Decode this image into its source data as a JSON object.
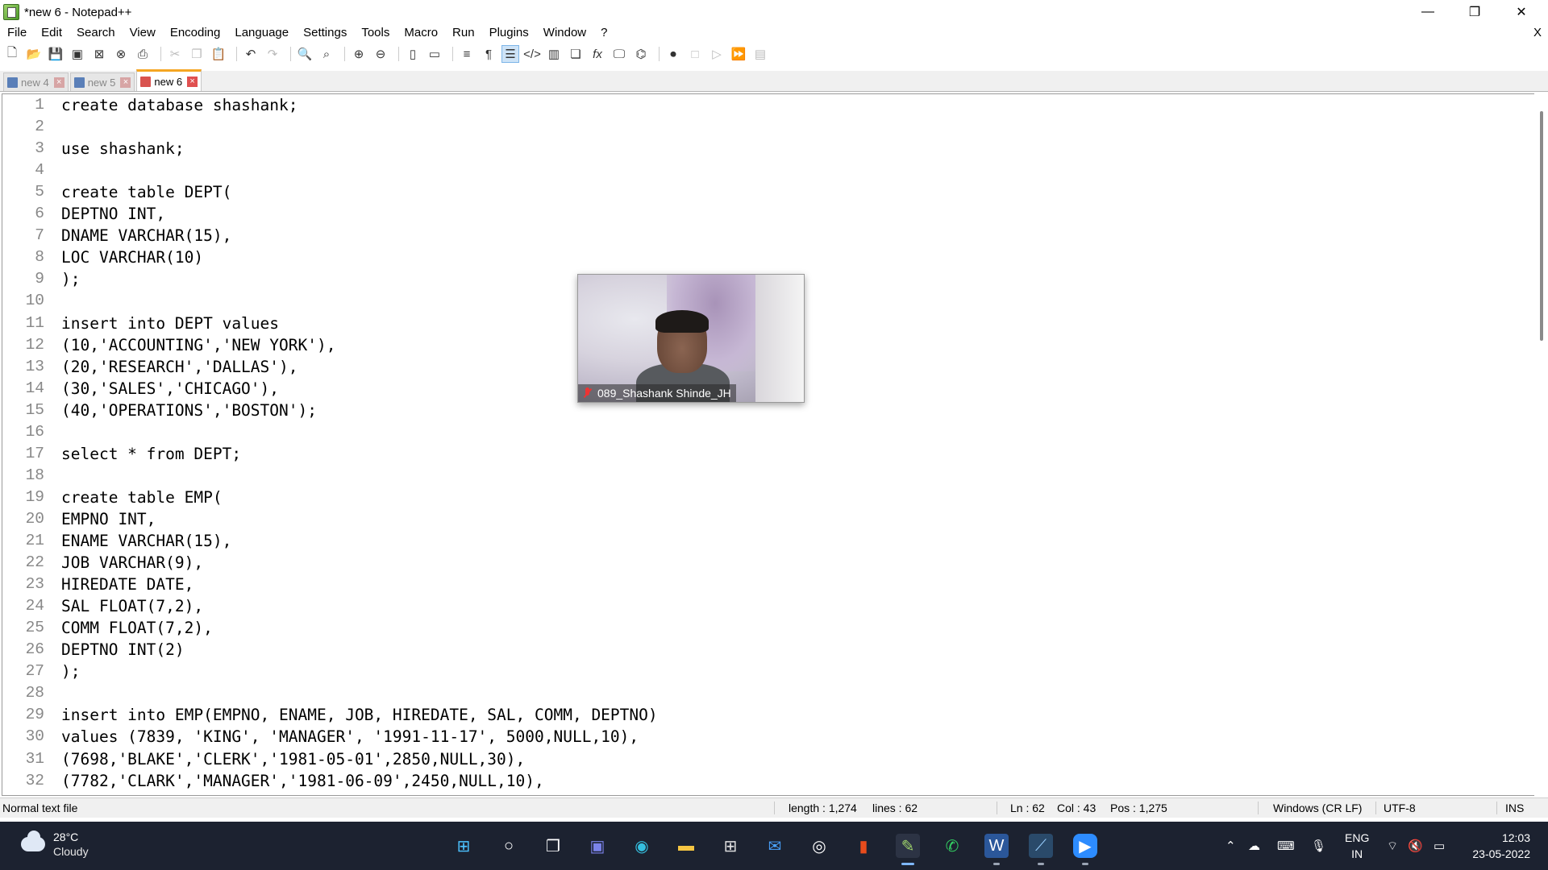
{
  "window": {
    "title": "*new 6 - Notepad++",
    "minimize_glyph": "—",
    "restore_glyph": "❐",
    "close_glyph": "✕"
  },
  "menu": {
    "items": [
      "File",
      "Edit",
      "Search",
      "View",
      "Encoding",
      "Language",
      "Settings",
      "Tools",
      "Macro",
      "Run",
      "Plugins",
      "Window",
      "?"
    ],
    "close_doc": "X"
  },
  "toolbar": {
    "icons": [
      "new-file-icon",
      "open-file-icon",
      "save-icon",
      "save-all-icon",
      "close-icon",
      "close-all-icon",
      "print-icon",
      "cut-icon",
      "copy-icon",
      "paste-icon",
      "undo-icon",
      "redo-icon",
      "find-icon",
      "replace-icon",
      "zoom-in-icon",
      "zoom-out-icon",
      "sync-vertical-icon",
      "sync-horizontal-icon",
      "word-wrap-icon",
      "show-all-chars-icon",
      "indent-guide-icon",
      "xml-tag-icon",
      "document-map-icon",
      "function-list-icon",
      "fx-icon",
      "monitor-icon",
      "folder-workspace-icon",
      "record-macro-icon",
      "stop-macro-icon",
      "play-macro-icon",
      "run-multiple-macro-icon",
      "save-macro-icon"
    ]
  },
  "tabs": [
    {
      "label": "new 4",
      "active": false
    },
    {
      "label": "new 5",
      "active": false
    },
    {
      "label": "new 6",
      "active": true
    }
  ],
  "editor": {
    "lines": [
      "create database shashank;",
      "",
      "use shashank;",
      "",
      "create table DEPT(",
      "DEPTNO INT,",
      "DNAME VARCHAR(15),",
      "LOC VARCHAR(10)",
      ");",
      "",
      "insert into DEPT values",
      "(10,'ACCOUNTING','NEW YORK'),",
      "(20,'RESEARCH','DALLAS'),",
      "(30,'SALES','CHICAGO'),",
      "(40,'OPERATIONS','BOSTON');",
      "",
      "select * from DEPT;",
      "",
      "create table EMP(",
      "EMPNO INT,",
      "ENAME VARCHAR(15),",
      "JOB VARCHAR(9),",
      "HIREDATE DATE,",
      "SAL FLOAT(7,2),",
      "COMM FLOAT(7,2),",
      "DEPTNO INT(2)",
      ");",
      "",
      "insert into EMP(EMPNO, ENAME, JOB, HIREDATE, SAL, COMM, DEPTNO)",
      "values (7839, 'KING', 'MANAGER', '1991-11-17', 5000,NULL,10),",
      "(7698,'BLAKE','CLERK','1981-05-01',2850,NULL,30),",
      "(7782,'CLARK','MANAGER','1981-06-09',2450,NULL,10),"
    ]
  },
  "video": {
    "participant": "089_Shashank Shinde_JH"
  },
  "status": {
    "file_type": "Normal text file",
    "length": "length : 1,274",
    "lines": "lines : 62",
    "ln": "Ln : 62",
    "col": "Col : 43",
    "pos": "Pos : 1,275",
    "eol": "Windows (CR LF)",
    "encoding": "UTF-8",
    "mode": "INS"
  },
  "taskbar": {
    "weather_temp": "28°C",
    "weather_desc": "Cloudy",
    "lang_line1": "ENG",
    "lang_line2": "IN",
    "time": "12:03",
    "date": "23-05-2022"
  },
  "colors": {
    "accent_tab": "#f5a623",
    "taskbar_bg": "#1c2230"
  }
}
